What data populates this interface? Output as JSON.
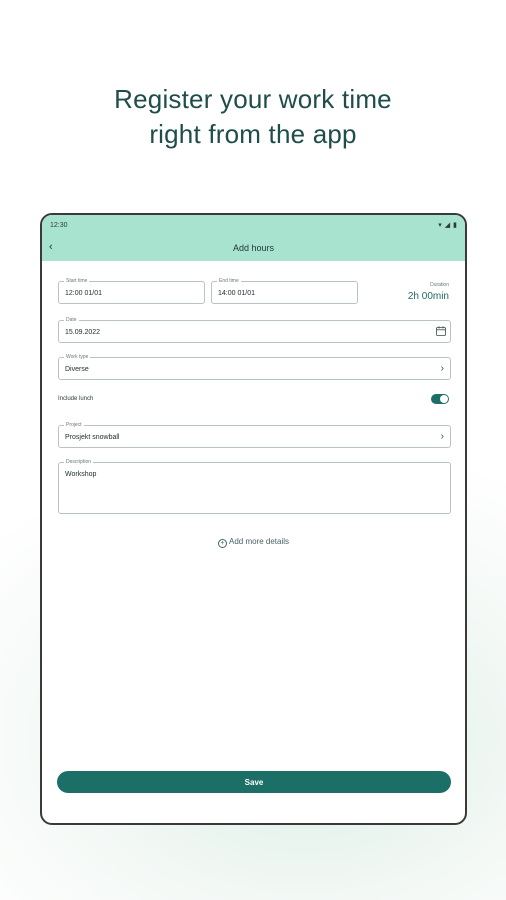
{
  "headline": {
    "line1": "Register your work time",
    "line2": "right from the app"
  },
  "status_bar": {
    "time": "12:30",
    "icons": [
      "wifi-icon",
      "signal-icon",
      "battery-icon"
    ]
  },
  "app_bar": {
    "title": "Add hours",
    "back_icon": "chevron-left-icon"
  },
  "form": {
    "start_time": {
      "label": "Start time",
      "value": "12:00   01/01"
    },
    "end_time": {
      "label": "End time",
      "value": "14:00   01/01"
    },
    "duration": {
      "label": "Duration",
      "value": "2h 00min"
    },
    "date": {
      "label": "Date",
      "value": "15.09.2022",
      "icon": "calendar-icon"
    },
    "work_type": {
      "label": "Work type",
      "value": "Diverse"
    },
    "include_lunch": {
      "label": "Include lunch",
      "on": true
    },
    "project": {
      "label": "Project",
      "value": "Prosjekt snowball"
    },
    "description": {
      "label": "Description",
      "value": "Workshop"
    },
    "add_more": "Add more details"
  },
  "save_button": "Save",
  "colors": {
    "accent": "#1c6f66",
    "app_bar": "#a8e3d0",
    "headline": "#1f4d4a"
  }
}
